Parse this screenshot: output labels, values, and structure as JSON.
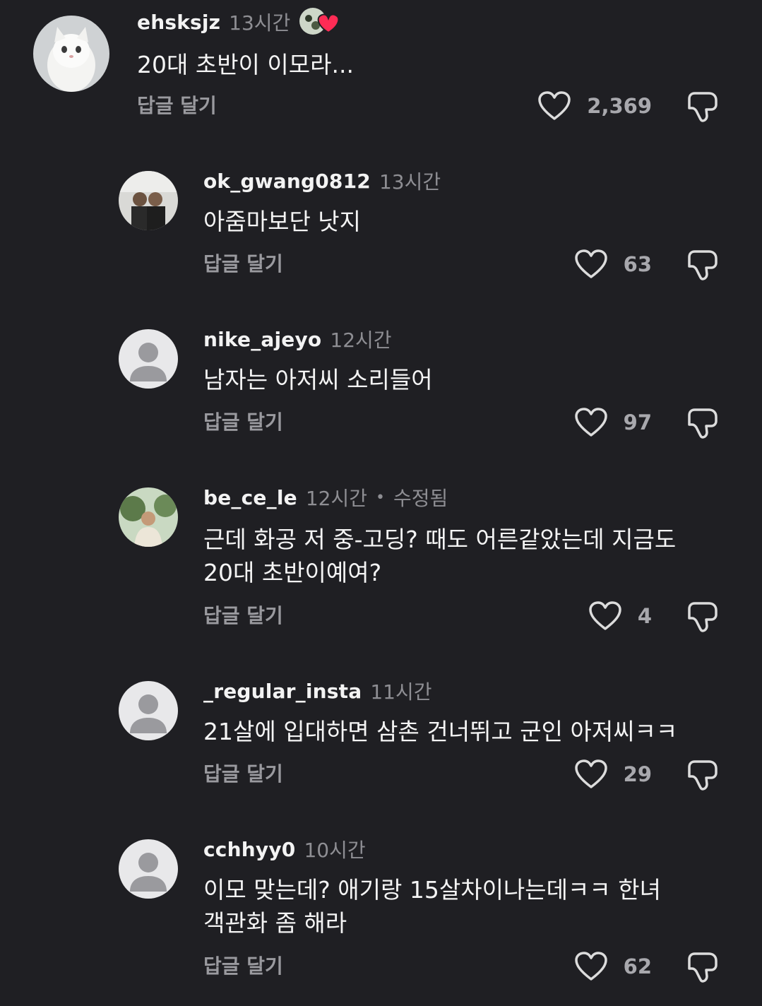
{
  "comments": [
    {
      "username": "ehsksjz",
      "time": "13시간",
      "text": "20대 초반이 이모라...",
      "reply_label": "답글 달기",
      "likes": "2,369",
      "avatar": "white-cat-photo",
      "creator_liked_badge": true
    },
    {
      "username": "ok_gwang0812",
      "time": "13시간",
      "text": "아줌마보단 낫지",
      "reply_label": "답글 달기",
      "likes": "63",
      "avatar": "two-people-selfie-photo"
    },
    {
      "username": "nike_ajeyo",
      "time": "12시간",
      "text": "남자는 아저씨 소리들어",
      "reply_label": "답글 달기",
      "likes": "97",
      "avatar": "default-person-icon"
    },
    {
      "username": "be_ce_le",
      "time": "12시간",
      "edited": "수정됨",
      "text": "근데 화공 저 중-고딩? 때도 어른같았는데 지금도\n20대 초반이예여?",
      "reply_label": "답글 달기",
      "likes": "4",
      "avatar": "person-outdoors-photo"
    },
    {
      "username": "_regular_insta",
      "time": "11시간",
      "text": "21살에 입대하면 삼촌 건너뛰고 군인 아저씨ㅋㅋ",
      "reply_label": "답글 달기",
      "likes": "29",
      "avatar": "default-person-icon"
    },
    {
      "username": "cchhyy0",
      "time": "10시간",
      "text": "이모 맞는데? 애기랑 15살차이나는데ㅋㅋ 한녀\n객관화 좀 해라",
      "reply_label": "답글 달기",
      "likes": "62",
      "avatar": "default-person-icon"
    }
  ],
  "icons": {
    "like": "heart-outline-icon",
    "dislike": "thumbs-down-outline-icon"
  },
  "colors": {
    "background": "#1f1f23",
    "text": "#f4f4f4",
    "muted": "#8e8e93",
    "badge_heart": "#fe2c55"
  }
}
